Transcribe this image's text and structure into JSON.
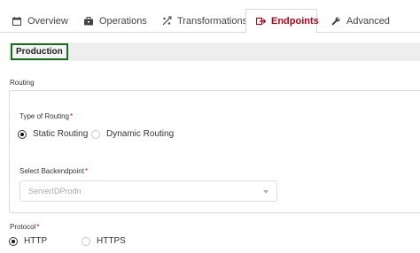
{
  "tabs": [
    {
      "label": "Overview",
      "icon": "calendar-icon"
    },
    {
      "label": "Operations",
      "icon": "briefcase-icon"
    },
    {
      "label": "Transformations",
      "icon": "transform-icon"
    },
    {
      "label": "Endpoints",
      "icon": "endpoints-icon",
      "active": true
    },
    {
      "label": "Advanced",
      "icon": "wrench-icon"
    }
  ],
  "environment": {
    "label": "Production"
  },
  "routing": {
    "section_label": "Routing",
    "type_label": "Type of Routing",
    "options": [
      "Static Routing",
      "Dynamic Routing"
    ],
    "selected": "Static Routing",
    "backend_label": "Select Backendpoint",
    "backend_value": "ServerIDProdn"
  },
  "protocol": {
    "label": "Protocol",
    "options": [
      "HTTP",
      "HTTPS"
    ],
    "selected": "HTTP"
  },
  "colors": {
    "accent": "#b3001a",
    "required": "#d0021b",
    "env_border": "#1a6b1a"
  }
}
